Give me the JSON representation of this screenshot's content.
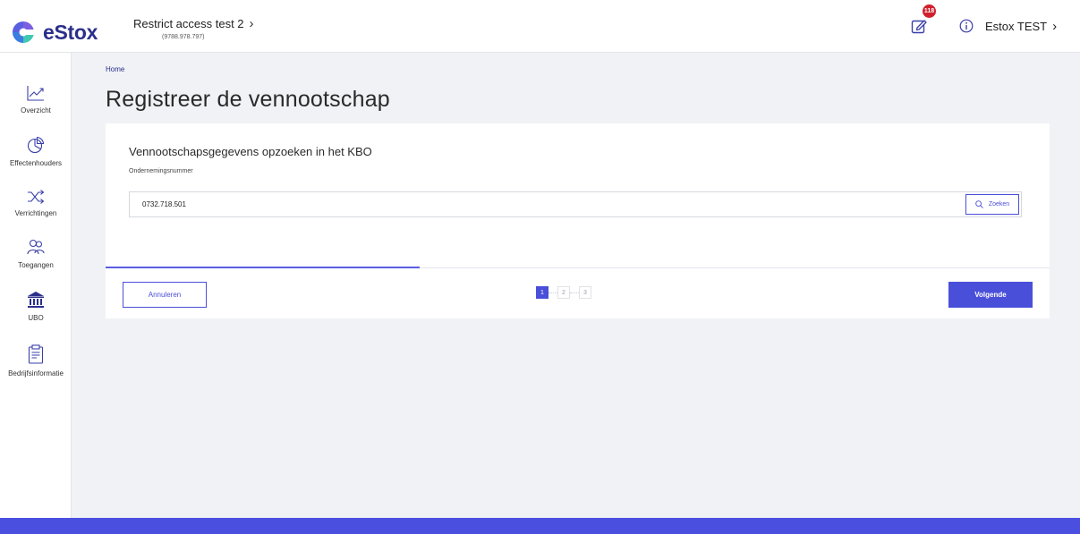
{
  "header": {
    "logo_text": "eStox",
    "company_name": "Restrict access test 2",
    "company_id": "(9788.978.797)",
    "notifications_count": "118",
    "user_name": "Estox TEST"
  },
  "sidebar": {
    "items": [
      {
        "label": "Overzicht",
        "icon": "chart-line-icon"
      },
      {
        "label": "Effectenhouders",
        "icon": "pie-chart-icon"
      },
      {
        "label": "Verrichtingen",
        "icon": "shuffle-icon"
      },
      {
        "label": "Toegangen",
        "icon": "users-icon"
      },
      {
        "label": "UBO",
        "icon": "bank-icon"
      },
      {
        "label": "Bedrijfsinformatie",
        "icon": "clipboard-icon"
      }
    ]
  },
  "breadcrumb": "Home",
  "page_title": "Registreer de vennootschap",
  "form": {
    "section_title": "Vennootschapsgegevens opzoeken in het KBO",
    "field_label": "Ondernemingsnummer",
    "field_value": "0732.718.501",
    "search_label": "Zoeken"
  },
  "wizard": {
    "progress_fraction": 0.333,
    "current_step": 1,
    "steps": [
      "1",
      "2",
      "3"
    ],
    "cancel_label": "Annuleren",
    "next_label": "Volgende"
  },
  "colors": {
    "accent": "#4a4fd9",
    "brand_dark": "#2b2f8a",
    "badge": "#d0202e"
  }
}
